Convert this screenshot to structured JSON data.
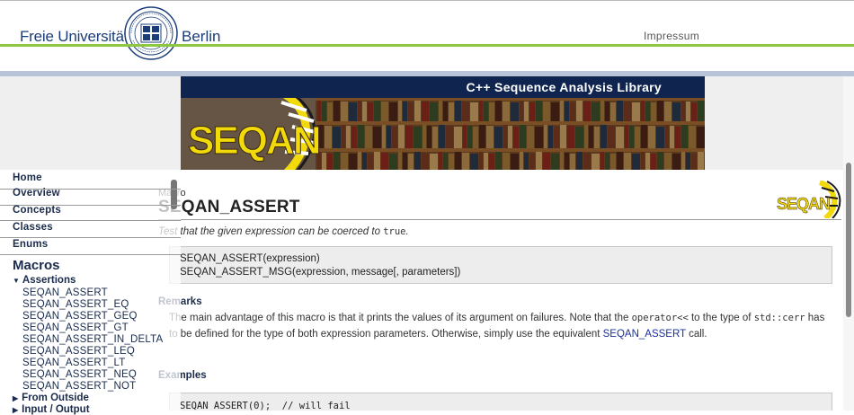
{
  "fu_header": {
    "name_left": "Freie Universität",
    "name_right": "Berlin",
    "impressum": "Impressum",
    "green": "#8dc63f",
    "blue": "#1b3d79"
  },
  "banner": {
    "title": "C++ Sequence Analysis Library",
    "logo_text": "SEQAN",
    "bar_color": "#0f2550",
    "logo_color": "#f2d90a"
  },
  "sidebar": {
    "nav": [
      "Home",
      "Overview",
      "Concepts",
      "Classes",
      "Enums"
    ],
    "macros_heading": "Macros",
    "groups": [
      {
        "label": "Assertions",
        "expanded": true
      },
      {
        "label": "From Outside",
        "expanded": false
      },
      {
        "label": "Input / Output",
        "expanded": false
      }
    ],
    "items": [
      "SEQAN_ASSERT",
      "SEQAN_ASSERT_EQ",
      "SEQAN_ASSERT_GEQ",
      "SEQAN_ASSERT_GT",
      "SEQAN_ASSERT_IN_DELTA",
      "SEQAN_ASSERT_LEQ",
      "SEQAN_ASSERT_LT",
      "SEQAN_ASSERT_NEQ",
      "SEQAN_ASSERT_NOT"
    ]
  },
  "main": {
    "kind": "Macro",
    "title": "SEQAN_ASSERT",
    "summary_prefix": "Test that the given expression can be coerced to ",
    "summary_code": "true",
    "summary_suffix": ".",
    "signatures": [
      "SEQAN_ASSERT(expression)",
      "SEQAN_ASSERT_MSG(expression, message[, parameters])"
    ],
    "remarks_heading": "Remarks",
    "remarks": {
      "t1": "The main advantage of this macro is that it prints the values of its argument on failures. Note that the ",
      "c1": "operator<<",
      "t2": " to the type of ",
      "c2": "std::cerr",
      "t3": " has to be defined for the type of both expression parameters. Otherwise, simply use the equivalent ",
      "link": "SEQAN_ASSERT",
      "t4": " call."
    },
    "examples_heading": "Examples",
    "example_code": "SEQAN_ASSERT(0);  // will fail"
  }
}
